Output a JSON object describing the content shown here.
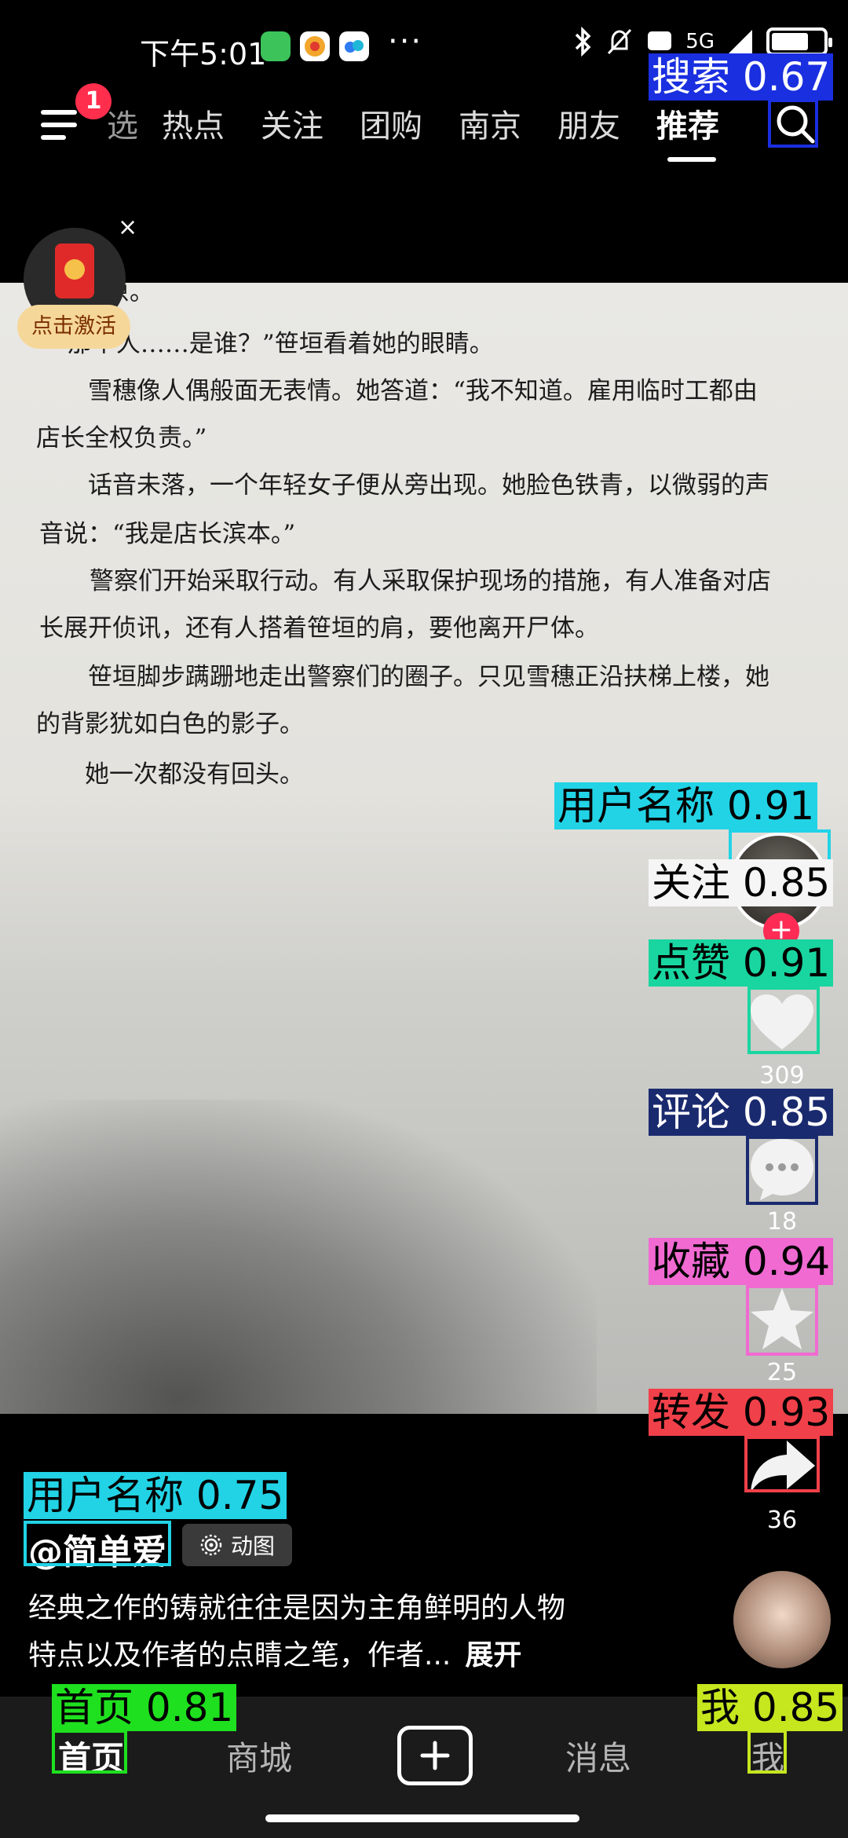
{
  "status_bar": {
    "time": "下午5:01",
    "dots": "···",
    "network": "5G",
    "app_icons": [
      "green-app-icon",
      "58-app-icon",
      "cloud-app-icon"
    ],
    "app_colors": [
      "#3cc35a",
      "#ffffff",
      "#ffffff"
    ]
  },
  "top_nav": {
    "notification_count": "1",
    "tabs": [
      "选",
      "热点",
      "关注",
      "团购",
      "南京",
      "朋友",
      "推荐"
    ],
    "active_tab": "推荐"
  },
  "book_text": [
    "月桐原。",
    "“那个人……是谁？”笹垣看着她的眼睛。",
    "　　雪穗像人偶般面无表情。她答道：“我不知道。雇用临时工都由",
    "店长全权负责。”",
    "　　话音未落，一个年轻女子便从旁出现。她脸色铁青，以微弱的声",
    "音说：“我是店长滨本。”",
    "　　警察们开始采取行动。有人采取保护现场的措施，有人准备对店",
    "长展开侦讯，还有人搭着笹垣的肩，要他离开尸体。",
    "　　笹垣脚步蹒跚地走出警察们的圈子。只见雪穗正沿扶梯上楼，她",
    "的背影犹如白色的影子。",
    "　　她一次都没有回头。"
  ],
  "red_packet": {
    "label": "点击激活",
    "close": "×",
    "colors": {
      "envelope": "#e02a2a",
      "pill": "#f6d79a"
    }
  },
  "actions": {
    "like_count": "309",
    "comment_count": "18",
    "favorite_count": "25",
    "share_count": "36"
  },
  "post": {
    "username": "@简单爱",
    "chip_label": "动图",
    "description_line1": "经典之作的铸就往往是因为主角鲜明的人物",
    "description_line2": "特点以及作者的点睛之笔，作者...",
    "expand_label": "展开"
  },
  "bottom_nav": {
    "items": [
      "首页",
      "商城",
      "",
      "消息",
      "我"
    ],
    "active": "首页"
  },
  "detections": [
    {
      "label": "搜索 0.67",
      "color": "#1a2fe0"
    },
    {
      "label": "用户名称 0.91",
      "color": "#22d3e6"
    },
    {
      "label": "关注 0.85",
      "color": "#f5f5f5"
    },
    {
      "label": "点赞 0.91",
      "color": "#19d6a0"
    },
    {
      "label": "评论 0.85",
      "color": "#1a2a6e"
    },
    {
      "label": "收藏 0.94",
      "color": "#f06ad2"
    },
    {
      "label": "转发 0.93",
      "color": "#f0404a"
    },
    {
      "label": "用户名称 0.75",
      "color": "#22d3e6"
    },
    {
      "label": "首页 0.81",
      "color": "#1fe01f"
    },
    {
      "label": "我 0.85",
      "color": "#c6e61e"
    }
  ]
}
